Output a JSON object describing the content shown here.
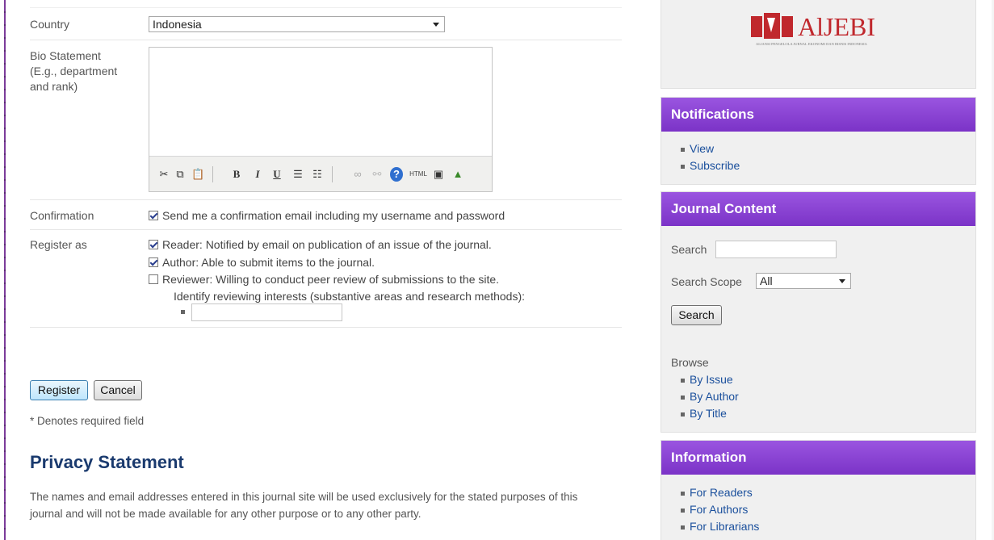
{
  "form": {
    "country": {
      "label": "Country",
      "value": "Indonesia"
    },
    "bio": {
      "label_lines": [
        "Bio Statement",
        "(E.g., department",
        "and rank)"
      ]
    },
    "editor_toolbar": {
      "buttons": [
        {
          "name": "cut-icon",
          "glyph": "✂"
        },
        {
          "name": "copy-icon",
          "glyph": "⧉"
        },
        {
          "name": "paste-icon",
          "glyph": "📋"
        },
        {
          "name": "bold-icon",
          "glyph": "B"
        },
        {
          "name": "italic-icon",
          "glyph": "I"
        },
        {
          "name": "underline-icon",
          "glyph": "U"
        },
        {
          "name": "bullet-list-icon",
          "glyph": "☰"
        },
        {
          "name": "numbered-list-icon",
          "glyph": "☷"
        },
        {
          "name": "link-icon",
          "glyph": "∞"
        },
        {
          "name": "unlink-icon",
          "glyph": "⚯"
        },
        {
          "name": "help-icon",
          "glyph": "?"
        },
        {
          "name": "html-icon",
          "glyph": "HTML"
        },
        {
          "name": "fullscreen-icon",
          "glyph": "▣"
        },
        {
          "name": "insert-image-icon",
          "glyph": "▲"
        }
      ]
    },
    "confirmation": {
      "label": "Confirmation",
      "text": "Send me a confirmation email including my username and password",
      "checked": true
    },
    "register_as": {
      "label": "Register as",
      "options": [
        {
          "text": "Reader: Notified by email on publication of an issue of the journal.",
          "checked": true
        },
        {
          "text": "Author: Able to submit items to the journal.",
          "checked": true
        },
        {
          "text": "Reviewer: Willing to conduct peer review of submissions to the site.",
          "checked": false
        }
      ],
      "interests_label": "Identify reviewing interests (substantive areas and research methods):"
    },
    "buttons": {
      "register": "Register",
      "cancel": "Cancel"
    },
    "required_note": "* Denotes required field"
  },
  "privacy": {
    "title": "Privacy Statement",
    "text": "The names and email addresses entered in this journal site will be used exclusively for the stated purposes of this journal and will not be made available for any other purpose or to any other party."
  },
  "sidebar": {
    "logo_text": "AlJEBI",
    "logo_subtext": "Aliansi Pengelola Jurnal Ekonomi dan Bisnis Indonesia",
    "notifications": {
      "title": "Notifications",
      "items": [
        "View",
        "Subscribe"
      ]
    },
    "journal_content": {
      "title": "Journal Content",
      "search_label": "Search",
      "scope_label": "Search Scope",
      "scope_value": "All",
      "search_button": "Search",
      "browse_label": "Browse",
      "browse_items": [
        "By Issue",
        "By Author",
        "By Title"
      ]
    },
    "information": {
      "title": "Information",
      "items": [
        "For Readers",
        "For Authors",
        "For Librarians"
      ]
    }
  },
  "colors": {
    "accent": "#8a44d6",
    "link": "#1a4f9c",
    "heading": "#1a3a6e"
  }
}
